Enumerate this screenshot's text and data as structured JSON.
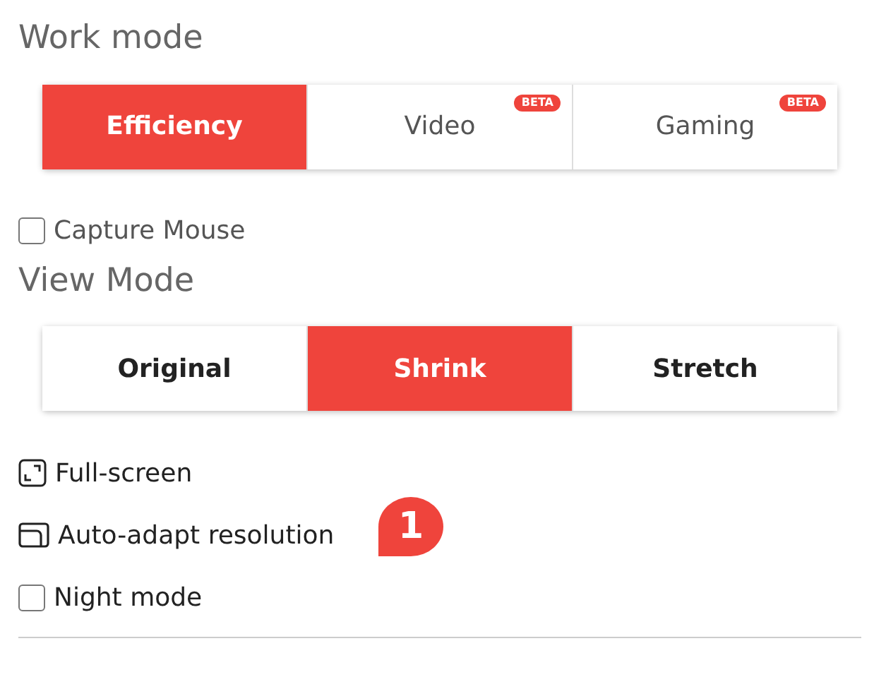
{
  "work_mode": {
    "title": "Work mode",
    "options": [
      {
        "label": "Efficiency",
        "selected": true
      },
      {
        "label": "Video",
        "selected": false,
        "badge": "BETA"
      },
      {
        "label": "Gaming",
        "selected": false,
        "badge": "BETA"
      }
    ]
  },
  "capture_mouse": {
    "label": "Capture Mouse",
    "checked": false
  },
  "view_mode": {
    "title": "View Mode",
    "options": [
      {
        "label": "Original",
        "selected": false
      },
      {
        "label": "Shrink",
        "selected": true
      },
      {
        "label": "Stretch",
        "selected": false
      }
    ]
  },
  "items": [
    {
      "kind": "fullscreen",
      "label": "Full-screen"
    },
    {
      "kind": "adapt",
      "label": "Auto-adapt resolution"
    },
    {
      "kind": "checkbox",
      "label": "Night mode",
      "checked": false
    }
  ],
  "callout": {
    "text": "1"
  }
}
